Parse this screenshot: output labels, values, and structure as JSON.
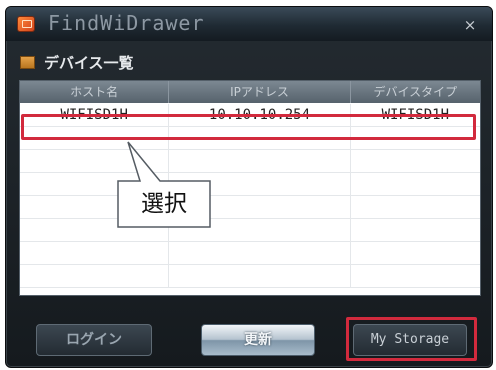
{
  "window": {
    "title": "FindWiDrawer",
    "close_glyph": "×"
  },
  "section": {
    "label": "デバイス一覧",
    "icon": "folder-icon"
  },
  "table": {
    "columns": [
      "ホスト名",
      "IPアドレス",
      "デバイスタイプ"
    ],
    "rows": [
      [
        "WIFISD1H",
        "10.10.10.254",
        "WIFISD1H"
      ]
    ]
  },
  "annotation": {
    "callout_text": "選択",
    "highlight_color": "#d22a3d"
  },
  "buttons": {
    "login_label": "ログイン",
    "refresh_label": "更新",
    "storage_label": "My Storage"
  }
}
